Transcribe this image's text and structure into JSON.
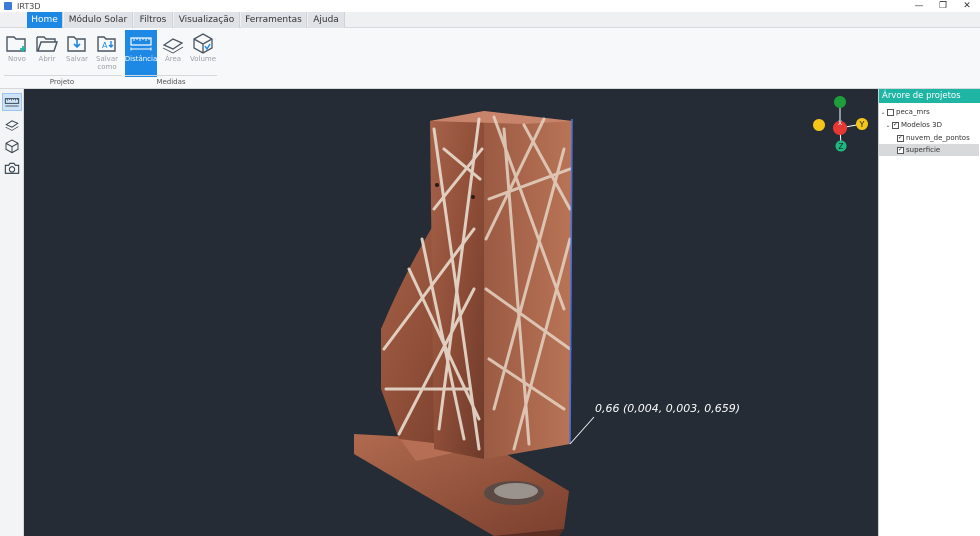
{
  "window": {
    "title": "IRT3D",
    "minimize": "—",
    "restore": "❐",
    "close": "✕"
  },
  "menu": {
    "tabs": [
      {
        "label": "Home"
      },
      {
        "label": "Módulo Solar"
      },
      {
        "label": "Filtros"
      },
      {
        "label": "Visualização"
      },
      {
        "label": "Ferramentas"
      },
      {
        "label": "Ajuda"
      }
    ],
    "active": "Home"
  },
  "ribbon": {
    "groups": [
      {
        "label": "Projeto"
      },
      {
        "label": "Medidas"
      }
    ],
    "buttons": [
      {
        "label": "Novo",
        "icon": "new-folder-icon"
      },
      {
        "label": "Abrir",
        "icon": "open-folder-icon"
      },
      {
        "label": "Salvar",
        "icon": "save-icon"
      },
      {
        "label": "Salvar como",
        "icon": "save-as-icon"
      },
      {
        "label": "Distância",
        "icon": "ruler-icon"
      },
      {
        "label": "Área",
        "icon": "area-icon"
      },
      {
        "label": "Volume",
        "icon": "volume-cube-icon"
      }
    ],
    "active_button": "Distância"
  },
  "left_toolbar": {
    "tools": [
      {
        "icon": "ruler-icon"
      },
      {
        "icon": "area-icon"
      },
      {
        "icon": "volume-cube-icon"
      },
      {
        "icon": "camera-icon"
      }
    ]
  },
  "viewport": {
    "measurement_label": "0,66  (0,004, 0,003, 0,659)",
    "axes": {
      "x": "X",
      "y": "Y",
      "z": "Z"
    },
    "colors": {
      "background": "#252c35",
      "x_axis": "#e53935",
      "y_axis": "#f5c518",
      "z_axis": "#1eb980",
      "green_axis": "#1e9e3a",
      "measure_line": "#4a6fd8"
    }
  },
  "project_tree": {
    "header": "Árvore de projetos",
    "items": [
      {
        "label": "peca_mrs",
        "checked": false,
        "expanded": true
      },
      {
        "label": "Modelos 3D",
        "checked": true,
        "expanded": true
      },
      {
        "label": "nuvem_de_pontos",
        "checked": true
      },
      {
        "label": "superficie",
        "checked": true,
        "selected": true
      }
    ],
    "check_mark": "✓",
    "chevron": "⌄"
  }
}
